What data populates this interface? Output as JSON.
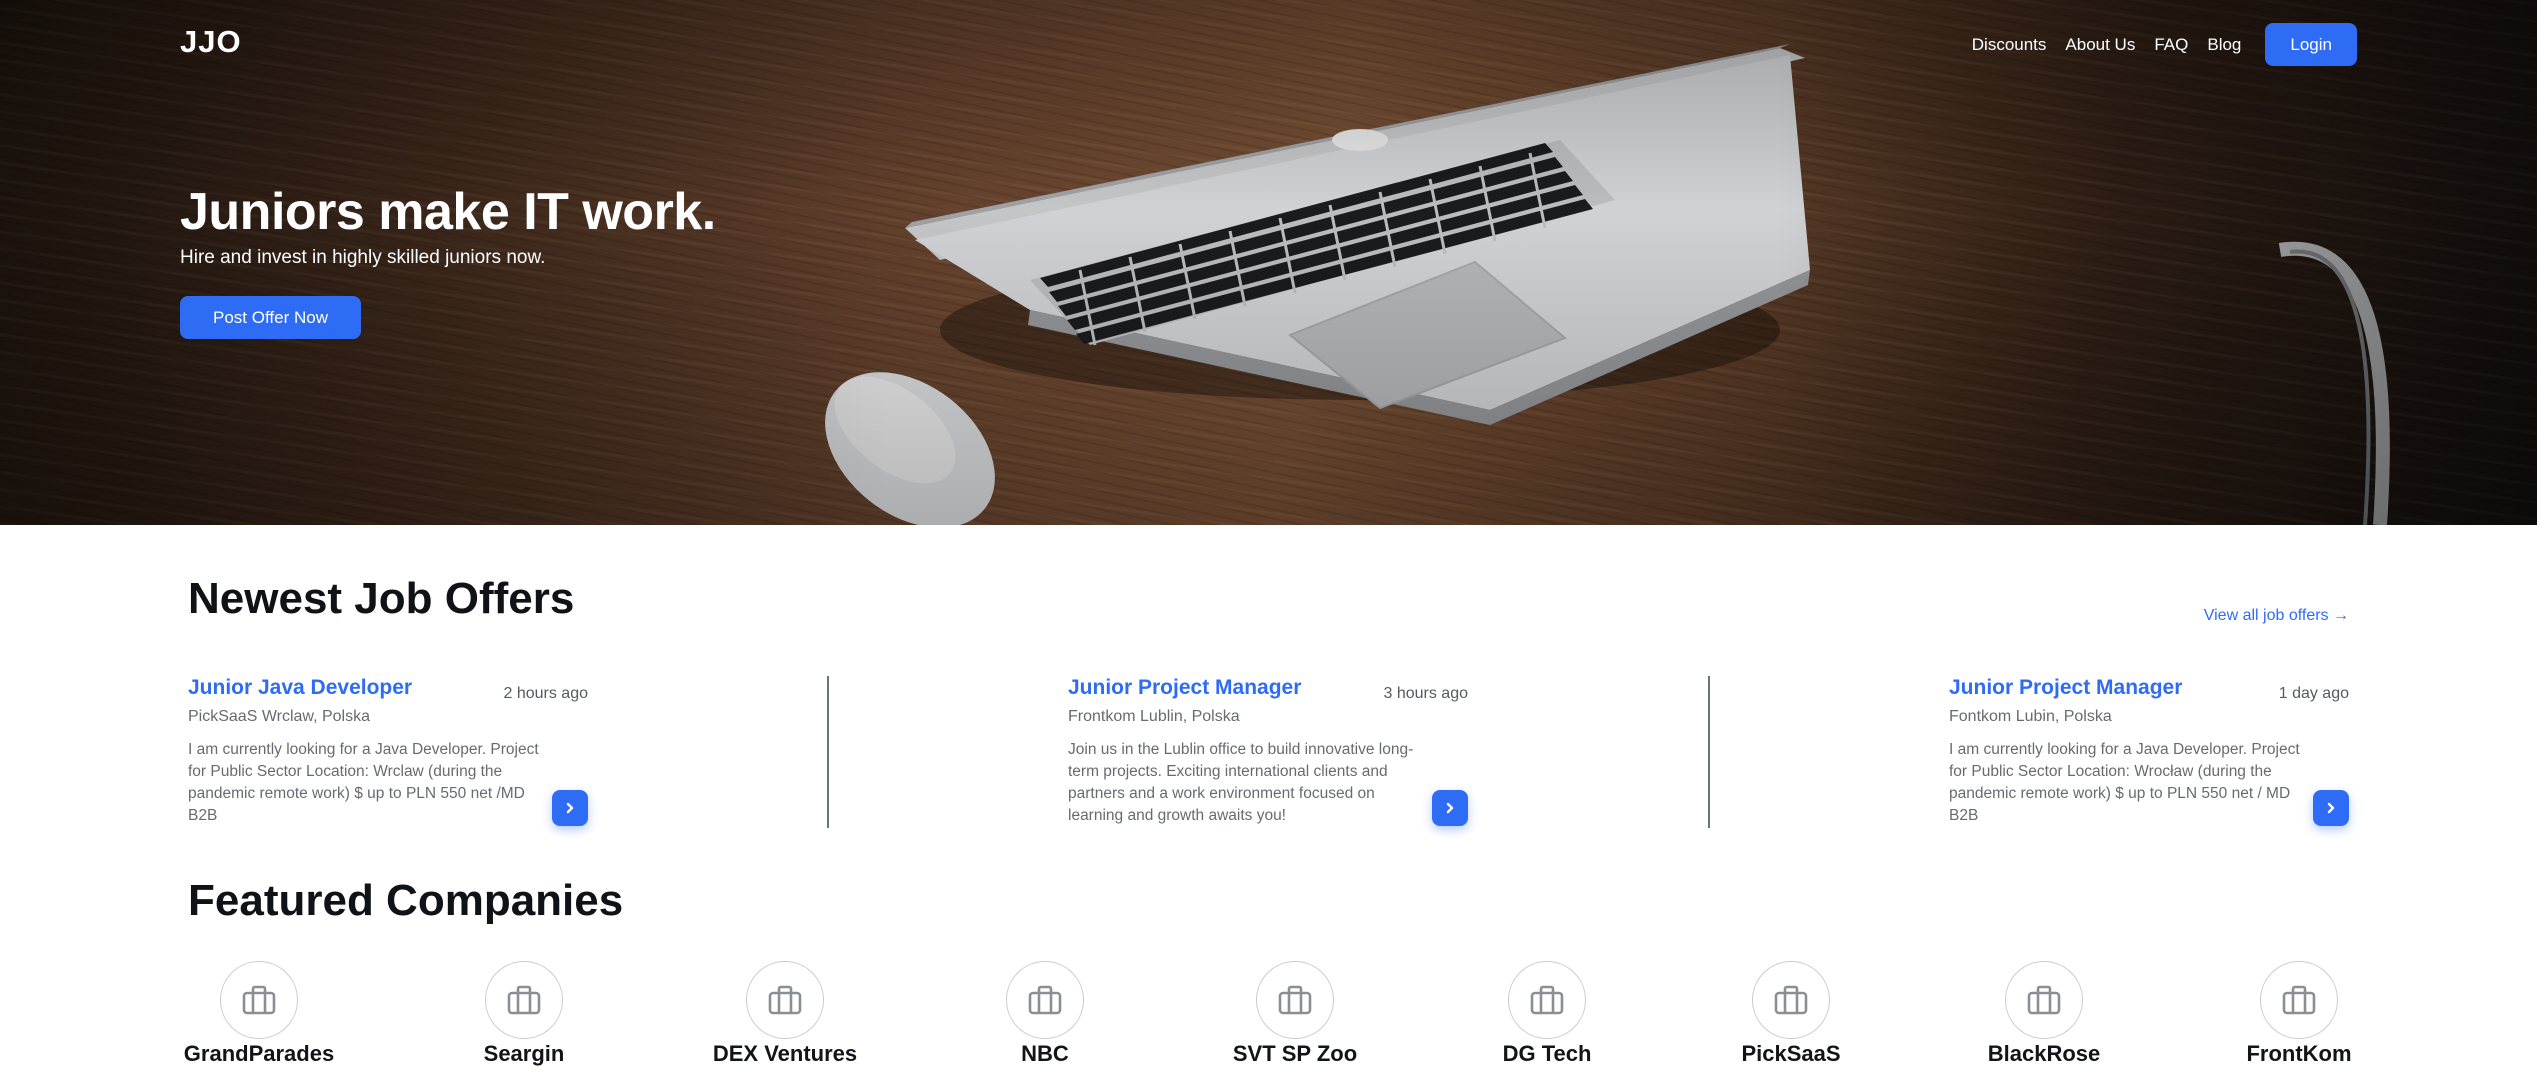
{
  "colors": {
    "accent": "#2f6cf6",
    "text_dark": "#111418",
    "text_muted": "#666b72"
  },
  "header": {
    "logo": "JJO",
    "nav": [
      "Discounts",
      "About Us",
      "FAQ",
      "Blog"
    ],
    "login_label": "Login"
  },
  "hero": {
    "title": "Juniors make IT work.",
    "subtitle": "Hire and invest in highly skilled juniors now.",
    "cta_label": "Post Offer Now"
  },
  "jobs": {
    "title": "Newest Job Offers",
    "view_all": "View all job offers →",
    "items": [
      {
        "title": "Junior Java Developer",
        "time": "2 hours ago",
        "company": "PickSaaS Wrclaw, Polska",
        "desc": "I am currently looking for a Java Developer. Project for Public Sector Location: Wrclaw (during the pandemic remote work) $ up to PLN 550 net /MD B2B",
        "icon": "chevron-right-icon"
      },
      {
        "title": "Junior Project Manager",
        "time": "3 hours ago",
        "company": "Frontkom Lublin, Polska",
        "desc": "Join us in the Lublin office to build innovative long-term projects. Exciting international clients and partners and a work environment focused on learning and growth awaits you!",
        "icon": "chevron-right-icon"
      },
      {
        "title": "Junior Project Manager",
        "time": "1 day ago",
        "company": "Fontkom Lubin, Polska",
        "desc": "I am currently looking for a Java Developer. Project for Public Sector Location: Wrocław (during the pandemic remote work) $ up to PLN 550 net / MD B2B",
        "icon": "chevron-right-icon"
      }
    ]
  },
  "companies": {
    "title": "Featured Companies",
    "items": [
      "GrandParades",
      "Seargin",
      "DEX Ventures",
      "NBC",
      "SVT SP Zoo",
      "DG Tech",
      "PickSaaS",
      "BlackRose",
      "FrontKom"
    ],
    "icon": "briefcase-icon"
  }
}
